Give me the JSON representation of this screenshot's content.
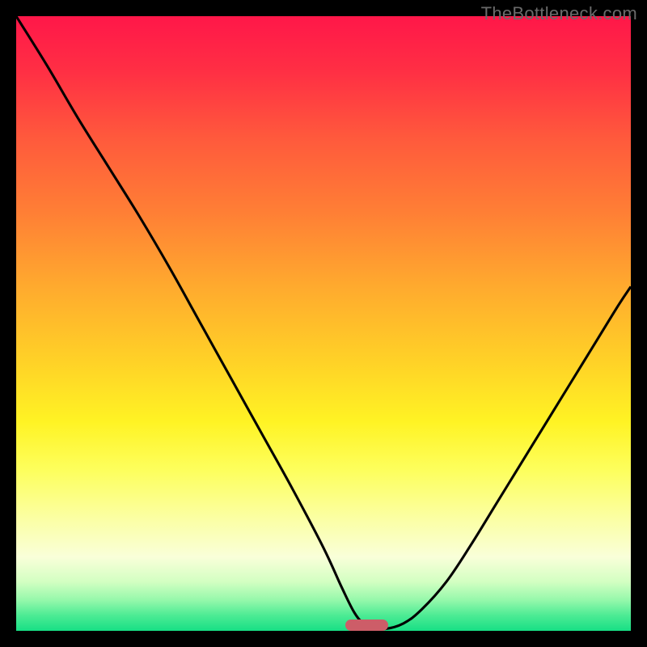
{
  "watermark": {
    "text": "TheBottleneck.com"
  },
  "chart_data": {
    "type": "line",
    "title": "",
    "xlabel": "",
    "ylabel": "",
    "xlim": [
      0,
      100
    ],
    "ylim": [
      0,
      100
    ],
    "series": [
      {
        "name": "bottleneck-curve",
        "x": [
          0,
          5,
          10,
          15,
          20,
          25,
          30,
          35,
          40,
          45,
          50,
          53,
          55,
          56.5,
          58,
          60,
          63,
          66,
          70,
          74,
          78,
          82,
          86,
          90,
          94,
          98,
          100
        ],
        "values": [
          100,
          92,
          83.5,
          75.5,
          67.5,
          59,
          50,
          41,
          32,
          23,
          13.5,
          7,
          3,
          1.2,
          0.3,
          0.3,
          1.2,
          3.5,
          8,
          14,
          20.5,
          27,
          33.5,
          40,
          46.5,
          53,
          56
        ]
      }
    ],
    "gradient_stops": [
      {
        "offset": 0.0,
        "color": "#ff1749"
      },
      {
        "offset": 0.09,
        "color": "#ff2f44"
      },
      {
        "offset": 0.2,
        "color": "#ff5a3c"
      },
      {
        "offset": 0.32,
        "color": "#ff7f35"
      },
      {
        "offset": 0.44,
        "color": "#ffaa2e"
      },
      {
        "offset": 0.56,
        "color": "#ffd127"
      },
      {
        "offset": 0.66,
        "color": "#fff324"
      },
      {
        "offset": 0.74,
        "color": "#fdff5e"
      },
      {
        "offset": 0.82,
        "color": "#fbffa6"
      },
      {
        "offset": 0.88,
        "color": "#f9ffd9"
      },
      {
        "offset": 0.92,
        "color": "#d3ffc2"
      },
      {
        "offset": 0.95,
        "color": "#95f8ab"
      },
      {
        "offset": 0.975,
        "color": "#4ceb94"
      },
      {
        "offset": 1.0,
        "color": "#17df85"
      }
    ],
    "marker": {
      "x_center_pct": 57,
      "width_pct": 7,
      "color": "#cd5d68"
    },
    "curve_color": "#000000",
    "curve_stroke_width": 3.1
  }
}
